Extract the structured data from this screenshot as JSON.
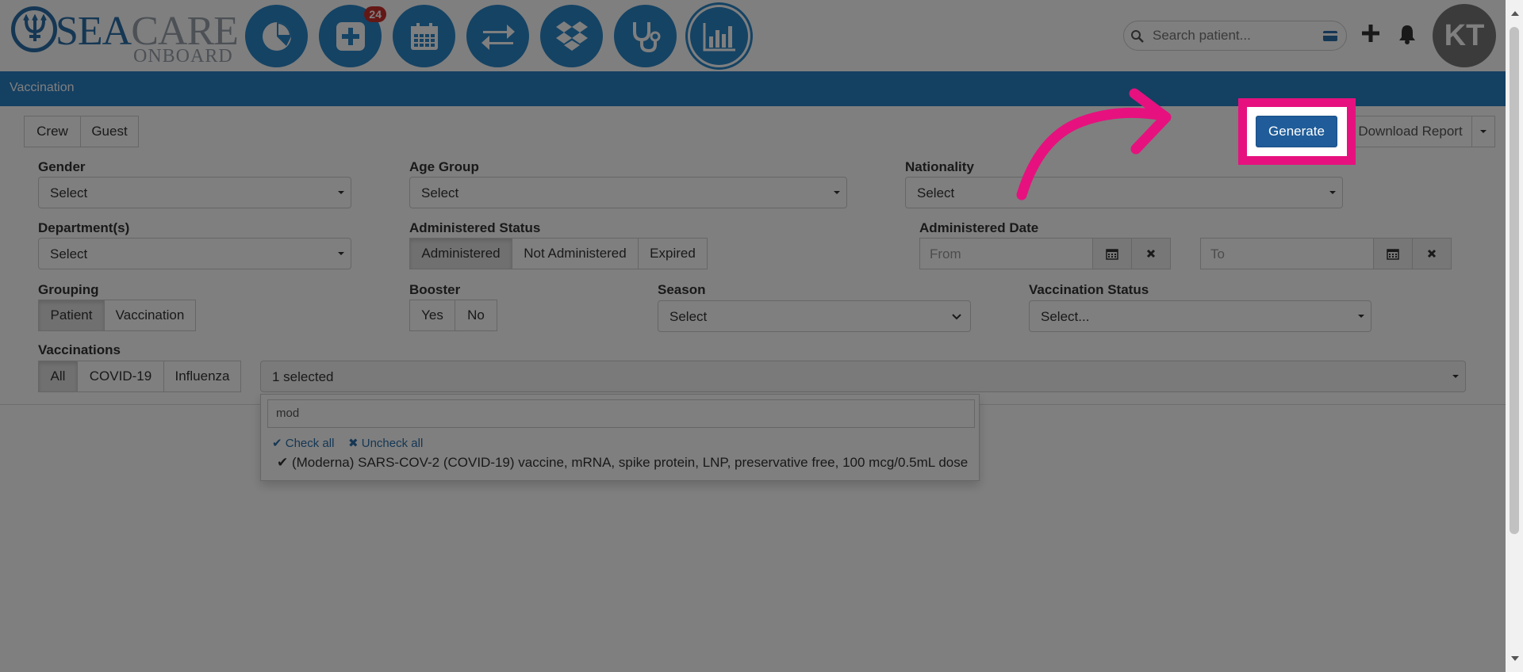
{
  "app": {
    "logo_main": "SEA",
    "logo_care": "CARE",
    "logo_sub": "ONBOARD",
    "notification_count": "24"
  },
  "nav": [
    "dashboard-chart",
    "add-record",
    "calendar",
    "transfer",
    "dropbox",
    "stethoscope",
    "reports-bar-chart"
  ],
  "search": {
    "placeholder": "Search patient..."
  },
  "user": {
    "initials": "KT"
  },
  "page": {
    "title": "Vaccination"
  },
  "patient_type": {
    "crew": "Crew",
    "guest": "Guest"
  },
  "actions": {
    "generate": "Generate",
    "download": "Download Report"
  },
  "filters": {
    "gender": {
      "label": "Gender",
      "value": "Select"
    },
    "age_group": {
      "label": "Age Group",
      "value": "Select"
    },
    "nationality": {
      "label": "Nationality",
      "value": "Select"
    },
    "departments": {
      "label": "Department(s)",
      "value": "Select"
    },
    "administered_status": {
      "label": "Administered Status",
      "options": [
        "Administered",
        "Not Administered",
        "Expired"
      ],
      "active": "Administered"
    },
    "administered_date": {
      "label": "Administered Date",
      "from_placeholder": "From",
      "to_placeholder": "To"
    },
    "grouping": {
      "label": "Grouping",
      "options": [
        "Patient",
        "Vaccination"
      ],
      "active": "Patient"
    },
    "booster": {
      "label": "Booster",
      "options": [
        "Yes",
        "No"
      ]
    },
    "season": {
      "label": "Season",
      "value": "Select"
    },
    "vaccination_status": {
      "label": "Vaccination Status",
      "value": "Select..."
    },
    "vaccinations": {
      "label": "Vaccinations",
      "options": [
        "All",
        "COVID-19",
        "Influenza"
      ],
      "active": "All",
      "selected_text": "1 selected"
    }
  },
  "dropdown": {
    "filter_value": "mod",
    "check_all": "Check all",
    "uncheck_all": "Uncheck all",
    "option": "(Moderna) SARS-COV-2 (COVID-19) vaccine, mRNA, spike protein, LNP, preservative free, 100 mcg/0.5mL dose"
  },
  "colors": {
    "primary": "#2980c4",
    "nav": "#2a86c9",
    "highlight": "#e6117e",
    "generate": "#1f5c99"
  }
}
